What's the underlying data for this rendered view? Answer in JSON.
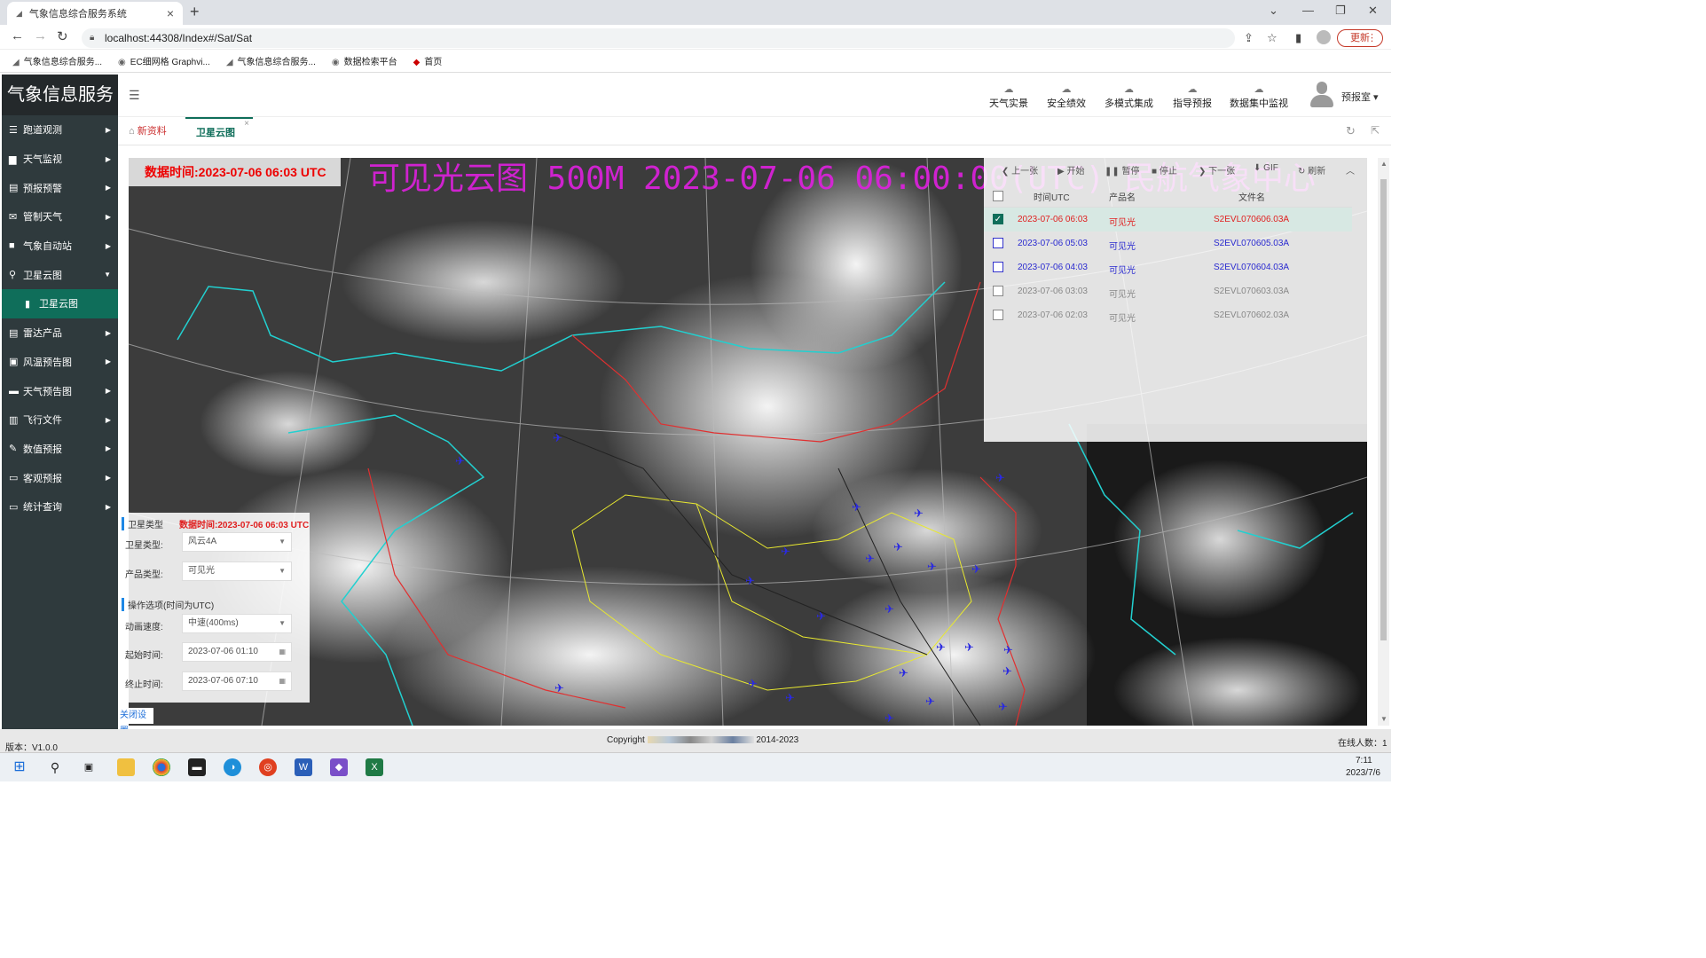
{
  "browser": {
    "tab_title": "气象信息综合服务系统",
    "url": "localhost:44308/Index#/Sat/Sat",
    "update_label": "更新",
    "bookmarks": [
      "气象信息综合服务...",
      "EC细网格 Graphvi...",
      "气象信息综合服务...",
      "数据检索平台",
      "首页"
    ]
  },
  "sidebar": {
    "logo": "气象信息服务",
    "items": [
      "跑道观测",
      "天气监视",
      "预报预警",
      "管制天气",
      "气象自动站",
      "卫星云图",
      "卫星云图",
      "雷达产品",
      "风温预告图",
      "天气预告图",
      "飞行文件",
      "数值预报",
      "客观预报",
      "统计查询"
    ]
  },
  "topnav": {
    "items": [
      "天气实景",
      "安全绩效",
      "多模式集成",
      "指导预报",
      "数据集中监视"
    ],
    "user": "预报室"
  },
  "page_tabs": [
    "新资料",
    "卫星云图"
  ],
  "map": {
    "data_time": "数据时间:2023-07-06 06:03 UTC",
    "title_overlay": "可见光云图 500M 2023-07-06 06:00:00(UTC) 民航气象中心"
  },
  "player": {
    "buttons": [
      "上一张",
      "开始",
      "暂停",
      "停止",
      "下一张",
      "GIF",
      "刷新"
    ],
    "columns": [
      "时间UTC",
      "产品名",
      "文件名"
    ],
    "rows": [
      {
        "time": "2023-07-06 06:03",
        "product": "可见光",
        "file": "S2EVL070606.03A",
        "checked": true,
        "color": "#e02020"
      },
      {
        "time": "2023-07-06 05:03",
        "product": "可见光",
        "file": "S2EVL070605.03A",
        "checked": false,
        "color": "#2a2ad0"
      },
      {
        "time": "2023-07-06 04:03",
        "product": "可见光",
        "file": "S2EVL070604.03A",
        "checked": false,
        "color": "#2a2ad0"
      },
      {
        "time": "2023-07-06 03:03",
        "product": "可见光",
        "file": "S2EVL070603.03A",
        "checked": false,
        "color": "#888888"
      },
      {
        "time": "2023-07-06 02:03",
        "product": "可见光",
        "file": "S2EVL070602.03A",
        "checked": false,
        "color": "#888888"
      }
    ]
  },
  "settings": {
    "section1": "卫星类型",
    "data_time": "数据时间:2023-07-06 06:03 UTC",
    "sat_label": "卫星类型:",
    "sat_value": "风云4A",
    "product_label": "产品类型:",
    "product_value": "可见光",
    "section2": "操作选项(时间为UTC)",
    "speed_label": "动画速度:",
    "speed_value": "中速(400ms)",
    "start_label": "起始时间:",
    "start_value": "2023-07-06 01:10",
    "end_label": "终止时间:",
    "end_value": "2023-07-06 07:10",
    "close_label": "关闭设置"
  },
  "footer": {
    "version": "版本：V1.0.0",
    "copyright": "Copyright",
    "years": "2014-2023",
    "online": "在线人数：",
    "online_count": "1"
  },
  "taskbar": {
    "time": "7:11",
    "date": "2023/7/6"
  },
  "colors": {
    "sidebar": "#2f3a3d",
    "active": "#0f6e5a",
    "accent_red": "#e02020"
  }
}
